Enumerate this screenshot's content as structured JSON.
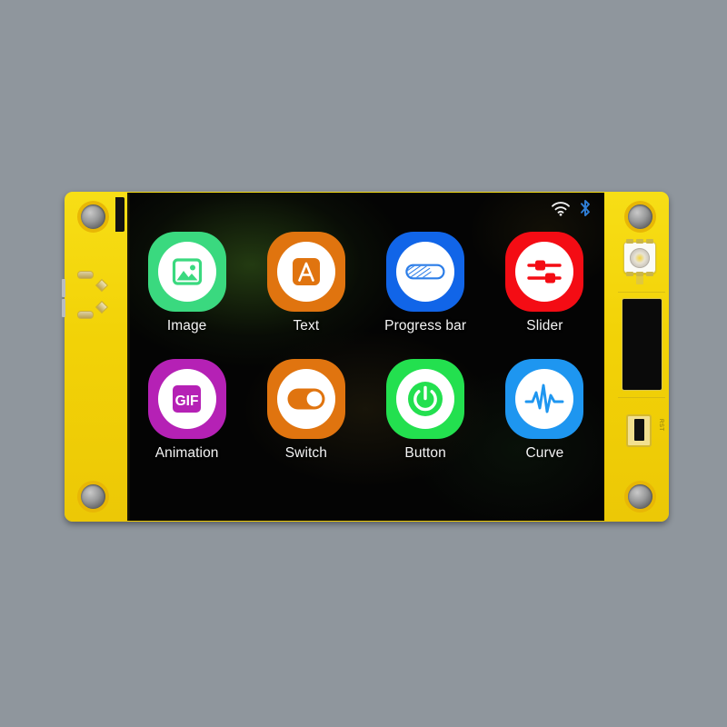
{
  "scene": {
    "background_color": "#8f969d",
    "device_name": "esp32-lcd-dev-board",
    "pcb_color": "#f2d207"
  },
  "screen": {
    "background_color": "#050505",
    "statusbar": {
      "wifi_icon": "wifi-icon",
      "wifi_color": "#f0f0f0",
      "bluetooth_icon": "bluetooth-icon",
      "bluetooth_color": "#2f7fd8"
    },
    "apps": [
      {
        "label": "Image",
        "icon": "image-icon",
        "tile_color": "#3ad97f",
        "glyph_color": "#3ad97f"
      },
      {
        "label": "Text",
        "icon": "text-icon",
        "tile_color": "#e0740f",
        "glyph_color": "#e0740f"
      },
      {
        "label": "Progress bar",
        "icon": "progress-bar-icon",
        "tile_color": "#1165e8",
        "glyph_color": "#2b7de8"
      },
      {
        "label": "Slider",
        "icon": "slider-icon",
        "tile_color": "#f40c14",
        "glyph_color": "#f40c14"
      },
      {
        "label": "Animation",
        "icon": "gif-icon",
        "tile_color": "#b521b5",
        "glyph_color": "#b521b5"
      },
      {
        "label": "Switch",
        "icon": "switch-icon",
        "tile_color": "#e0740f",
        "glyph_color": "#e0740f"
      },
      {
        "label": "Button",
        "icon": "power-button-icon",
        "tile_color": "#23e04f",
        "glyph_color": "#23e04f"
      },
      {
        "label": "Curve",
        "icon": "waveform-icon",
        "tile_color": "#1e96f0",
        "glyph_color": "#1e96f0"
      }
    ]
  },
  "board": {
    "left_edge": {
      "mounting_holes": 2,
      "pads": 4
    },
    "right_edge": {
      "mounting_holes": 2,
      "rgb_led": "rgb-led-component",
      "connector": "black-connector-component",
      "switch_label": "RST"
    }
  }
}
